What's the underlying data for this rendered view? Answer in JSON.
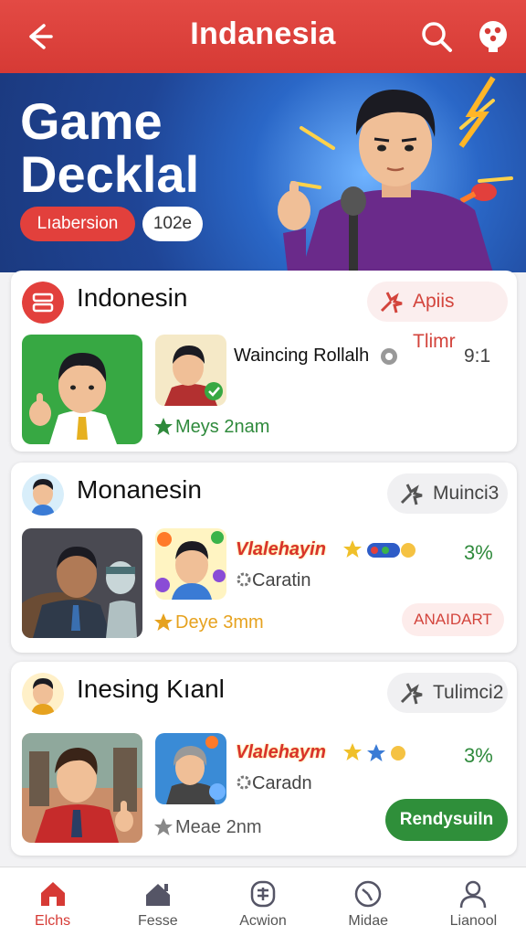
{
  "header": {
    "title": "Indanesia"
  },
  "hero": {
    "headline_line1": "Game",
    "headline_line2": "Decklal",
    "pill_primary": "Lıabersion",
    "pill_secondary": "102e"
  },
  "cards": [
    {
      "title": "Indonesin",
      "chip": "Apiis Tlimr",
      "game_name": "Waincing Rollalh",
      "score": "9:1",
      "rating": "Meys 2nam"
    },
    {
      "title": "Monanesin",
      "chip": "Muinci3",
      "game_name": "Vlalehayin",
      "genre": "Caratin",
      "percent": "3%",
      "rating": "Deye 3mm",
      "cta": "ANAIDART"
    },
    {
      "title": "Inesing Kıanl",
      "chip": "Tulimci2",
      "game_name": "Vlalehaym",
      "genre": "Caradn",
      "percent": "3%",
      "rating": "Meae 2nm",
      "cta": "Rendysuiln"
    }
  ],
  "bottom_nav": [
    {
      "label": "Elchs",
      "icon": "home-icon",
      "active": true
    },
    {
      "label": "Fesse",
      "icon": "house-icon"
    },
    {
      "label": "Acwion",
      "icon": "controller-icon"
    },
    {
      "label": "Midae",
      "icon": "clock-icon"
    },
    {
      "label": "Lianool",
      "icon": "user-icon"
    }
  ],
  "colors": {
    "brand_red": "#d63a35",
    "green": "#2f8f3a",
    "hero_blue": "#1f4596"
  }
}
